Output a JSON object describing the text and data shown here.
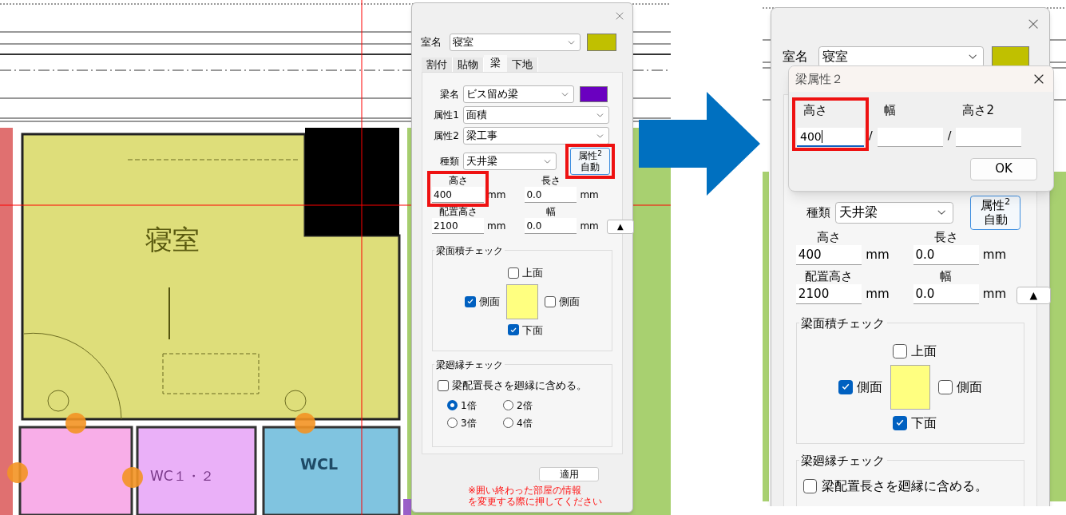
{
  "before": {
    "plan": {
      "room_labels": [
        "寝室",
        "WC１・２",
        "WCL"
      ]
    },
    "dialog": {
      "room": {
        "label": "室名",
        "value": "寝室",
        "color": "#c0c000"
      },
      "tabs": [
        {
          "label": "割付",
          "selected": false
        },
        {
          "label": "貼物",
          "selected": false
        },
        {
          "label": "梁",
          "selected": true
        },
        {
          "label": "下地",
          "selected": false
        }
      ],
      "beam_name": {
        "label": "梁名",
        "value": "ビス留め梁",
        "color": "#6a00c0"
      },
      "attr1": {
        "label": "属性1",
        "value": "面積"
      },
      "attr2": {
        "label": "属性2",
        "value": "梁工事"
      },
      "type": {
        "label": "種類",
        "value": "天井梁"
      },
      "auto_button": {
        "lines": [
          "属性$^{2}$",
          "自動"
        ],
        "highlighted": true
      },
      "height": {
        "label": "高さ",
        "value": "400",
        "unit": "mm",
        "highlighted": true
      },
      "length": {
        "label": "長さ",
        "value": "0.0",
        "unit": "mm"
      },
      "placement_height": {
        "label": "配置高さ",
        "value": "2100",
        "unit": "mm"
      },
      "width": {
        "label": "幅",
        "value": "0.0",
        "unit": "mm"
      },
      "up_button": "▲",
      "area_check": {
        "title": "梁面積チェック",
        "top": {
          "label": "上面",
          "checked": false
        },
        "left": {
          "label": "側面",
          "checked": true
        },
        "right": {
          "label": "側面",
          "checked": false
        },
        "bottom": {
          "label": "下面",
          "checked": true
        }
      },
      "molding_check": {
        "title": "梁廻縁チェック",
        "include": {
          "label": "梁配置長さを廻縁に含める。",
          "checked": false
        },
        "multipliers": [
          {
            "label": "1倍",
            "selected": true
          },
          {
            "label": "2倍",
            "selected": false
          },
          {
            "label": "3倍",
            "selected": false
          },
          {
            "label": "4倍",
            "selected": false
          }
        ]
      },
      "apply_button": "適用",
      "note": [
        "※囲い終わった部屋の情報",
        "を変更する際に押してください"
      ]
    }
  },
  "after": {
    "dialog": {
      "room": {
        "label": "室名",
        "value": "寝室",
        "color": "#c0c000"
      },
      "type": {
        "label": "種類",
        "value": "天井梁"
      },
      "auto_button": {
        "lines": [
          "属性$^{2}$",
          "自動"
        ],
        "highlighted": false
      },
      "height": {
        "label": "高さ",
        "value": "400",
        "unit": "mm",
        "highlighted": false
      },
      "length": {
        "label": "長さ",
        "value": "0.0",
        "unit": "mm"
      },
      "placement_height": {
        "label": "配置高さ",
        "value": "2100",
        "unit": "mm"
      },
      "width": {
        "label": "幅",
        "value": "0.0",
        "unit": "mm"
      },
      "up_button": "▲",
      "area_check": {
        "title": "梁面積チェック",
        "top": {
          "label": "上面",
          "checked": false
        },
        "left": {
          "label": "側面",
          "checked": true
        },
        "right": {
          "label": "側面",
          "checked": false
        },
        "bottom": {
          "label": "下面",
          "checked": true
        }
      },
      "molding_check": {
        "title": "梁廻縁チェック",
        "include": {
          "label": "梁配置長さを廻縁に含める。",
          "checked": false
        }
      }
    },
    "sub_dialog": {
      "title": "梁属性２",
      "fields": [
        {
          "label": "高さ",
          "value": "400",
          "focused": true,
          "highlighted": true
        },
        {
          "label": "幅",
          "separator": "/",
          "focused": false,
          "highlighted": false
        },
        {
          "label": "高さ2",
          "separator": "/",
          "focused": false,
          "highlighted": false
        }
      ],
      "ok_button": "OK"
    }
  }
}
